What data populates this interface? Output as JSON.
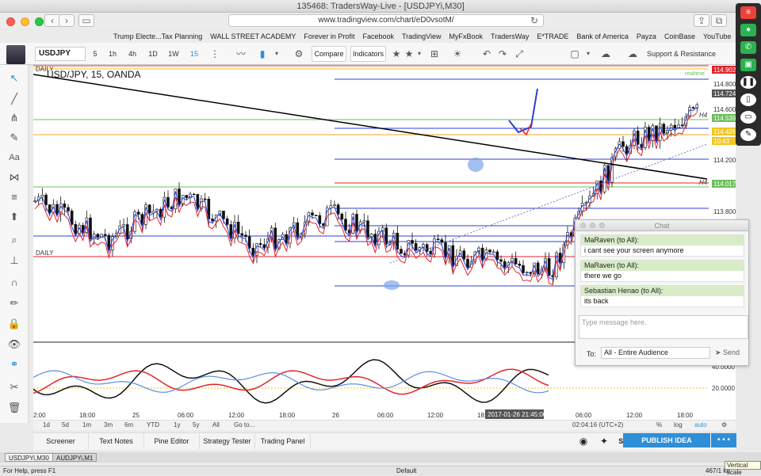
{
  "window": {
    "title": "135468: TradersWay-Live - [USDJPYi,M30]"
  },
  "browser": {
    "url": "www.tradingview.com/chart/eD0vsotM/",
    "bookmarks": [
      "Trump Electe...Tax Planning",
      "WALL STREET ACADEMY",
      "Forever in Profit",
      "Facebook",
      "TradingView",
      "MyFxBook",
      "TradersWay",
      "E*TRADE",
      "Bank of America",
      "Payza",
      "CoinBase",
      "YouTube"
    ]
  },
  "toolbar": {
    "symbol": "USDJPY",
    "timeframes": [
      "5",
      "1h",
      "4h",
      "1D",
      "1W",
      "15"
    ],
    "compare": "Compare",
    "indicators": "Indicators",
    "template_label": "Support & Resistance (W..."
  },
  "chart": {
    "label": "USD/JPY, 15, OANDA",
    "daily_top": "DAILY",
    "daily_mid": "DAILY",
    "h4_top": "H4",
    "h4_mid": "H4",
    "realtime": "realtime",
    "price_labels": [
      "114.902",
      "114.800",
      "114.724",
      "114.600",
      "114.539",
      "114.426",
      "10:43",
      "114.200",
      "114.017",
      "113.800"
    ],
    "osc_labels": [
      "40.0000",
      "20.0000"
    ],
    "time_labels": [
      "2:00",
      "18:00",
      "25",
      "06:00",
      "12:00",
      "18:00",
      "26",
      "06:00",
      "12:00",
      "18:00",
      "06:00",
      "12:00",
      "18:00"
    ],
    "crosshair_time": "2017-01-26 21:45:00",
    "colors": {
      "up_line": "#2d3fd6",
      "red_line": "#e2252b",
      "green_line": "#6cbf5a",
      "current_price": "#f5a623"
    }
  },
  "chart_data": {
    "type": "line",
    "title": "USD/JPY, 15, OANDA",
    "x": [
      "2:00",
      "18:00",
      "25",
      "06:00",
      "12:00",
      "18:00",
      "26",
      "06:00",
      "12:00",
      "18:00"
    ],
    "series": [
      {
        "values": [
          113.9,
          113.6,
          113.95,
          113.55,
          113.8,
          113.55,
          113.45,
          113.35,
          114.35,
          114.6
        ]
      }
    ],
    "ylim": [
      113.8,
      114.902
    ]
  },
  "range_bar": {
    "items": [
      "1d",
      "5d",
      "1m",
      "3m",
      "6m",
      "YTD",
      "1y",
      "5y",
      "All",
      "Go to..."
    ],
    "clock": "02:04:16 (UTC+2)",
    "pct": "%",
    "log": "log",
    "auto": "auto"
  },
  "bottom_panel": {
    "items": [
      "Screener",
      "Text Notes",
      "Pine Editor",
      "Strategy Tester",
      "Trading Panel"
    ],
    "publish": "PUBLISH IDEA",
    "more": "• • •"
  },
  "chat": {
    "title": "Chat",
    "messages": [
      {
        "who": "MaRaven (to All):",
        "text": "i cant see your screen anymore"
      },
      {
        "who": "MaRaven (to All):",
        "text": "there we go"
      },
      {
        "who": "Sebastian Henao (to All):",
        "text": "its back"
      }
    ],
    "input_placeholder": "Type message here.",
    "to_label": "To:",
    "to_value": "All - Entire Audience",
    "send": "Send"
  },
  "tabs": [
    "USDJPYi,M30",
    "AUDJPYi,M1"
  ],
  "status": {
    "help": "For Help, press F1",
    "mode": "Default",
    "info": "467/1 kb",
    "tooltip": "Vertical scale"
  }
}
